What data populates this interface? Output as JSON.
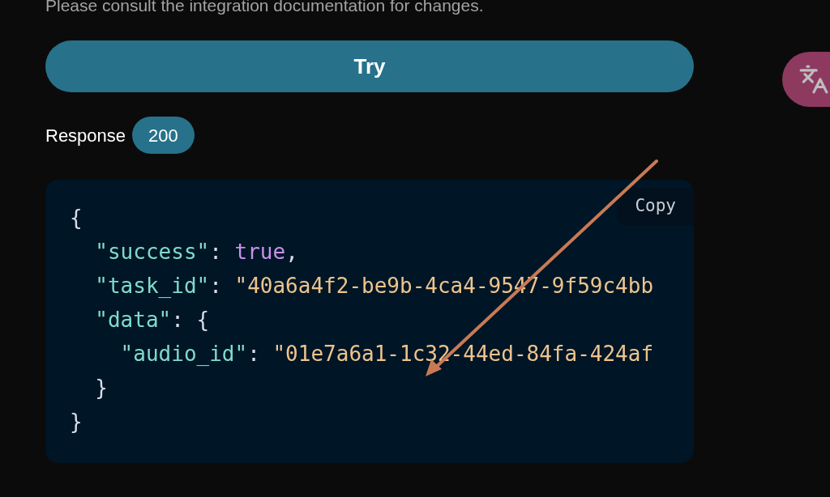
{
  "notice": "Please consult the integration documentation for changes.",
  "try_button": "Try",
  "response": {
    "label": "Response",
    "status": "200"
  },
  "code": {
    "copy_button": "Copy",
    "lines": [
      [
        {
          "kind": "punct",
          "text": "{"
        }
      ],
      [
        {
          "kind": "key",
          "text": "  \"success\""
        },
        {
          "kind": "punct",
          "text": ": "
        },
        {
          "kind": "bool",
          "text": "true"
        },
        {
          "kind": "punct",
          "text": ","
        }
      ],
      [
        {
          "kind": "key",
          "text": "  \"task_id\""
        },
        {
          "kind": "punct",
          "text": ": "
        },
        {
          "kind": "string",
          "text": "\"40a6a4f2-be9b-4ca4-9547-9f59c4bb"
        }
      ],
      [
        {
          "kind": "key",
          "text": "  \"data\""
        },
        {
          "kind": "punct",
          "text": ": {"
        }
      ],
      [
        {
          "kind": "key",
          "text": "    \"audio_id\""
        },
        {
          "kind": "punct",
          "text": ": "
        },
        {
          "kind": "string",
          "text": "\"01e7a6a1-1c32-44ed-84fa-424af"
        }
      ],
      [
        {
          "kind": "punct",
          "text": "  }"
        }
      ],
      [
        {
          "kind": "punct",
          "text": "}"
        }
      ]
    ]
  }
}
